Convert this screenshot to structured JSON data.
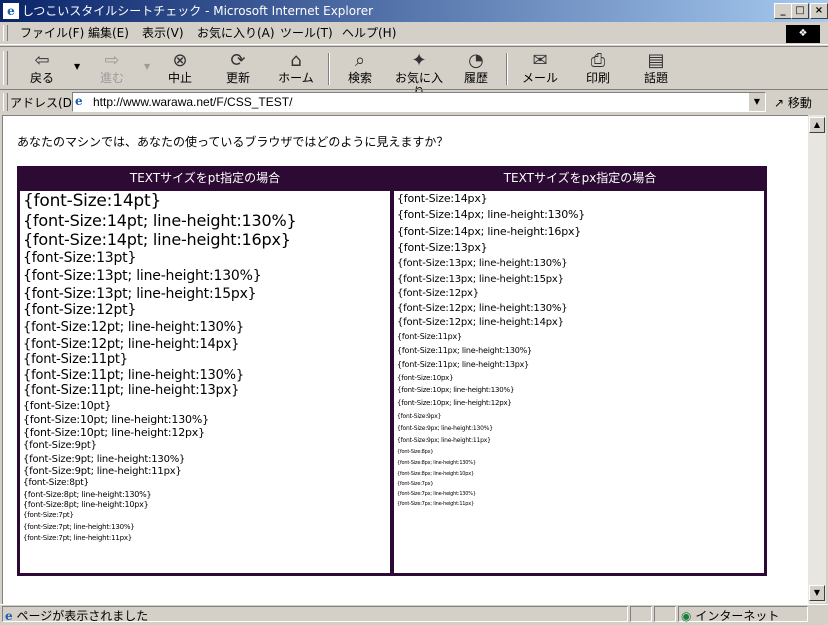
{
  "window": {
    "title": "しつこいスタイルシートチェック - Microsoft Internet Explorer",
    "minimize": "_",
    "maximize": "□",
    "close": "×"
  },
  "menu": [
    "ファイル(F)",
    "編集(E)",
    "表示(V)",
    "お気に入り(A)",
    "ツール(T)",
    "ヘルプ(H)"
  ],
  "toolbar": {
    "back": "戻る",
    "forward": "進む",
    "stop": "中止",
    "refresh": "更新",
    "home": "ホーム",
    "search": "検索",
    "favorites": "お気に入り",
    "history": "履歴",
    "mail": "メール",
    "print": "印刷",
    "discuss": "話題"
  },
  "address": {
    "label": "アドレス(D)",
    "url": "http://www.warawa.net/F/CSS_TEST/",
    "go": "移動"
  },
  "page": {
    "question": "あなたのマシンでは、あなたの使っているブラウザではどのように見えますか？",
    "pt_header": "TEXTサイズをpt指定の場合",
    "px_header": "TEXTサイズをpx指定の場合",
    "pt_lines": [
      "{font-Size:14pt}",
      "{font-Size:14pt; line-height:130%}",
      "{font-Size:14pt; line-height:16px}",
      "{font-Size:13pt}",
      "{font-Size:13pt; line-height:130%}",
      "{font-Size:13pt; line-height:15px}",
      "{font-Size:12pt}",
      "{font-Size:12pt; line-height:130%}",
      "{font-Size:12pt; line-height:14px}",
      "{font-Size:11pt}",
      "{font-Size:11pt; line-height:130%}",
      "{font-Size:11pt; line-height:13px}",
      "{font-Size:10pt}",
      "{font-Size:10pt; line-height:130%}",
      "{font-Size:10pt; line-height:12px}",
      "{font-Size:9pt}",
      "{font-Size:9pt; line-height:130%}",
      "{font-Size:9pt; line-height:11px}",
      "{font-Size:8pt}",
      "{font-Size:8pt; line-height:130%}",
      "{font-Size:8pt; line-height:10px}",
      "{font-Size:7pt}",
      "{font-Size:7pt; line-height:130%}",
      "{font-Size:7pt; line-height:11px}"
    ],
    "px_lines": [
      "{font-Size:14px}",
      "{font-Size:14px; line-height:130%}",
      "{font-Size:14px; line-height:16px}",
      "{font-Size:13px}",
      "{font-Size:13px; line-height:130%}",
      "{font-Size:13px; line-height:15px}",
      "{font-Size:12px}",
      "{font-Size:12px; line-height:130%}",
      "{font-Size:12px; line-height:14px}",
      "{font-Size:11px}",
      "{font-Size:11px; line-height:130%}",
      "{font-Size:11px; line-height:13px}",
      "{font-Size:10px}",
      "{font-Size:10px; line-height:130%}",
      "{font-Size:10px; line-height:12px}",
      "{font-Size:9px}",
      "{font-Size:9px; line-height:130%}",
      "{font-Size:9px; line-height:11px}",
      "{font-Size:8px}",
      "{font-Size:8px; line-height:130%}",
      "{font-Size:8px; line-height:10px}",
      "{font-Size:7px}",
      "{font-Size:7px; line-height:130%}",
      "{font-Size:7px; line-height:11px}"
    ]
  },
  "status": {
    "text": "ページが表示されました",
    "zone": "インターネット"
  },
  "icons": {
    "ie": "ie-logo-icon",
    "windows": "windows-logo-icon",
    "globe": "internet-zone-icon"
  },
  "colors": {
    "table_header": "#2c0a34",
    "titlebar_start": "#0a246a",
    "titlebar_end": "#a6caf0",
    "chrome": "#d4d0c8"
  }
}
